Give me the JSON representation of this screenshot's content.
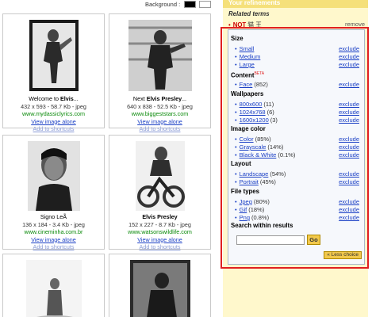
{
  "background": {
    "label": "Background :",
    "options": [
      "black",
      "white"
    ]
  },
  "results": [
    {
      "title_pre": "Welcome to ",
      "title_bold": "Elvis",
      "title_post": "...",
      "info": "432 x 593 - 58.7 Kb - jpeg",
      "url": "www.mydassiclyrics.com",
      "view": "View image alone",
      "shortcut": "Add to shortcuts"
    },
    {
      "title_pre": "Next ",
      "title_bold": "Elvis Presley",
      "title_post": "...",
      "info": "640 x 838 - 52.5 Kb - jpeg",
      "url": "www.biggeststars.com",
      "view": "View image alone",
      "shortcut": "Add to shortcuts"
    },
    {
      "title_pre": "Signo LeÃ",
      "title_bold": "",
      "title_post": "",
      "info": "136 x 184 - 3.4 Kb - jpeg",
      "url": "www.cineminha.com.br",
      "view": "View image alone",
      "shortcut": "Add to shortcuts"
    },
    {
      "title_pre": "",
      "title_bold": "Elvis Presley",
      "title_post": "",
      "info": "152 x 227 - 8.7 Kb - jpeg",
      "url": "www.watsonswildlife.com",
      "view": "View image alone",
      "shortcut": "Add to shortcuts"
    }
  ],
  "panel": {
    "header": "Your refinements",
    "related_terms": "Related terms",
    "not_label": "NOT",
    "not_term": "猫 王",
    "remove": "remove",
    "exclude": "exclude",
    "sections": {
      "size": {
        "title": "Size",
        "items": [
          {
            "label": "Small",
            "count": ""
          },
          {
            "label": "Medium",
            "count": ""
          },
          {
            "label": "Large",
            "count": ""
          }
        ]
      },
      "content": {
        "title": "Content",
        "beta": "BETA",
        "items": [
          {
            "label": "Face",
            "count": "(852)"
          }
        ]
      },
      "wallpapers": {
        "title": "Wallpapers",
        "items": [
          {
            "label": "800x600",
            "count": "(11)"
          },
          {
            "label": "1024x768",
            "count": "(6)"
          },
          {
            "label": "1600x1200",
            "count": "(3)"
          }
        ]
      },
      "color": {
        "title": "Image color",
        "items": [
          {
            "label": "Color",
            "count": "(85%)"
          },
          {
            "label": "Grayscale",
            "count": "(14%)"
          },
          {
            "label": "Black & White",
            "count": "(0.1%)"
          }
        ]
      },
      "layout": {
        "title": "Layout",
        "items": [
          {
            "label": "Landscape",
            "count": "(54%)"
          },
          {
            "label": "Portrait",
            "count": "(45%)"
          }
        ]
      },
      "filetypes": {
        "title": "File types",
        "items": [
          {
            "label": "Jpeg",
            "count": "(80%)"
          },
          {
            "label": "Gif",
            "count": "(18%)"
          },
          {
            "label": "Png",
            "count": "(0.8%)"
          }
        ]
      }
    },
    "search_within": "Search within results",
    "go": "Go",
    "less_choice": "« Less choice"
  }
}
